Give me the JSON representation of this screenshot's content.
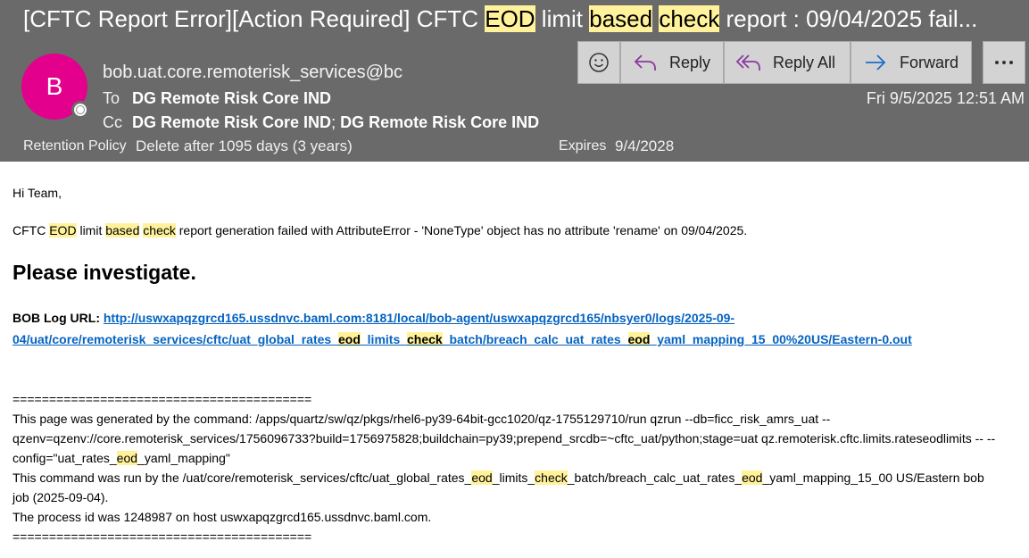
{
  "subject": {
    "prefix": "[CFTC Report Error][Action Required] CFTC ",
    "hl1": "EOD",
    "mid1": " limit ",
    "hl2": "based",
    "mid2": " ",
    "hl3": "check",
    "suffix": " report : 09/04/2025 fail..."
  },
  "sender": {
    "initial": "B",
    "address": "bob.uat.core.remoterisk_services@bc",
    "avatar_color": "#e3008c"
  },
  "to": {
    "label": "To",
    "value": "DG Remote Risk Core IND"
  },
  "cc": {
    "label": "Cc",
    "value1": "DG Remote Risk Core IND",
    "sep": ";",
    "value2": "DG Remote Risk Core IND"
  },
  "date": "Fri 9/5/2025 12:51 AM",
  "retention": {
    "label": "Retention Policy",
    "value": "Delete after 1095 days (3 years)"
  },
  "expires": {
    "label": "Expires",
    "value": "9/4/2028"
  },
  "toolbar": {
    "reply": "Reply",
    "reply_all": "Reply All",
    "forward": "Forward"
  },
  "icons": [
    "smiley-icon",
    "reply-icon",
    "reply-all-icon",
    "forward-icon",
    "more-icon"
  ],
  "body": {
    "greeting": "Hi Team,",
    "msg": {
      "a": "CFTC ",
      "h1": "EOD",
      "b": " limit ",
      "h2": "based",
      "c": " ",
      "h3": "check",
      "d": " report generation failed with AttributeError - 'NoneType' object has no attribute 'rename' on 09/04/2025."
    },
    "investigate": "Please investigate.",
    "log_label": "BOB Log URL:",
    "url": {
      "a": "http://uswxapqzgrcd165.ussdnvc.baml.com:8181/local/bob-agent/uswxapqzgrcd165/nbsyer0/logs/2025-09-04/uat/core/remoterisk_services/cftc/uat_global_rates_",
      "h1": "eod",
      "b": "_limits_",
      "h2": "check",
      "c": "_batch/breach_calc_uat_rates_",
      "h3": "eod",
      "d": "_yaml_mapping_15_00%20US/Eastern-0.out"
    },
    "separator": "=========================================",
    "gen": {
      "a": "This page was generated by the command: /apps/quartz/sw/qz/pkgs/rhel6-py39-64bit-gcc1020/qz-1755129710/run qzrun --db=ficc_risk_amrs_uat --qzenv=qzenv://core.remoterisk_services/1756096733?build=1756975828;buildchain=py39;prepend_srcdb=~cftc_uat/python;stage=uat qz.remoterisk.cftc.limits.rateseodlimits -- --config=\"uat_rates_",
      "h1": "eod",
      "b": "_yaml_mapping\""
    },
    "ran": {
      "a": "This command was run by the /uat/core/remoterisk_services/cftc/uat_global_rates_",
      "h1": "eod",
      "b": "_limits_",
      "h2": "check",
      "c": "_batch/breach_calc_uat_rates_",
      "h3": "eod",
      "d": "_yaml_mapping_15_00 US/Eastern bob job (2025-09-04)."
    },
    "process": "The process id was 1248987 on host uswxapqzgrcd165.ussdnvc.baml.com."
  }
}
